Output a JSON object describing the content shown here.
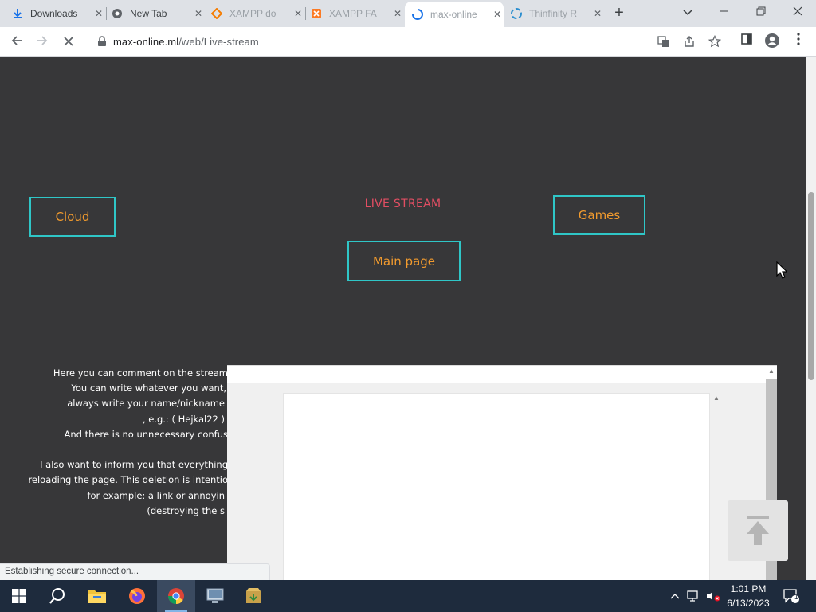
{
  "browser": {
    "tabs": [
      {
        "title": "Downloads",
        "icon": "download-icon",
        "active": false
      },
      {
        "title": "New Tab",
        "icon": "chrome-icon",
        "active": false
      },
      {
        "title": "XAMPP do",
        "icon": "xampp-diamond-icon",
        "active": false
      },
      {
        "title": "XAMPP FA",
        "icon": "xampp-logo-icon",
        "active": false
      },
      {
        "title": "max-online",
        "icon": "loading-spinner-icon",
        "active": true
      },
      {
        "title": "Thinfinity R",
        "icon": "thinfinity-icon",
        "active": false
      }
    ],
    "url_host": "max-online.ml",
    "url_path": "/web/Live-stream",
    "status_text": "Establishing secure connection..."
  },
  "page": {
    "title": "LIVE STREAM",
    "nav": {
      "cloud": "Cloud",
      "games": "Games",
      "main_page": "Main page"
    },
    "info_lines": [
      "Here you can comment on the stream",
      "You can write whatever you want,",
      "always write your name/nickname",
      ", e.g.: ( Hejkal22 )",
      "And there is no unnecessary confus",
      "",
      "I also want to inform you that everything",
      "reloading the page. This deletion is intentio",
      "for example: a link or annoyin",
      "(destroying the s"
    ]
  },
  "taskbar": {
    "time": "1:01 PM",
    "date": "6/13/2023",
    "notification_count": "1"
  },
  "colors": {
    "page_bg": "#373739",
    "button_border": "#2fc6c7",
    "button_text": "#f29b2e",
    "title": "#e24e63",
    "taskbar": "#1e2b3d"
  }
}
